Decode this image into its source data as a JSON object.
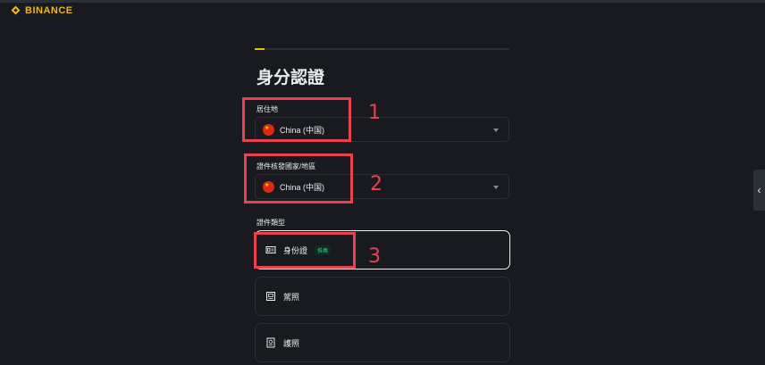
{
  "brand": {
    "name": "BINANCE",
    "color": "#f0b90b"
  },
  "progress": {
    "fraction": 0.04
  },
  "page": {
    "title": "身分認證"
  },
  "residence": {
    "label": "居住地",
    "value": "China (中国)",
    "flag_icon": "china-flag-icon"
  },
  "issuing_country": {
    "label": "證件核發國家/地區",
    "value": "China (中国)",
    "flag_icon": "china-flag-icon"
  },
  "document_type": {
    "label": "證件類型",
    "options": [
      {
        "label": "身份證",
        "badge": "推薦",
        "icon": "id-card-icon",
        "selected": true
      },
      {
        "label": "駕照",
        "icon": "driver-license-icon",
        "selected": false
      },
      {
        "label": "護照",
        "icon": "passport-icon",
        "selected": false
      }
    ]
  },
  "annotations": {
    "one": "1",
    "two": "2",
    "three": "3",
    "color": "#e8424e"
  },
  "side_tab": {
    "icon": "chevron-left-icon",
    "glyph": "‹"
  }
}
